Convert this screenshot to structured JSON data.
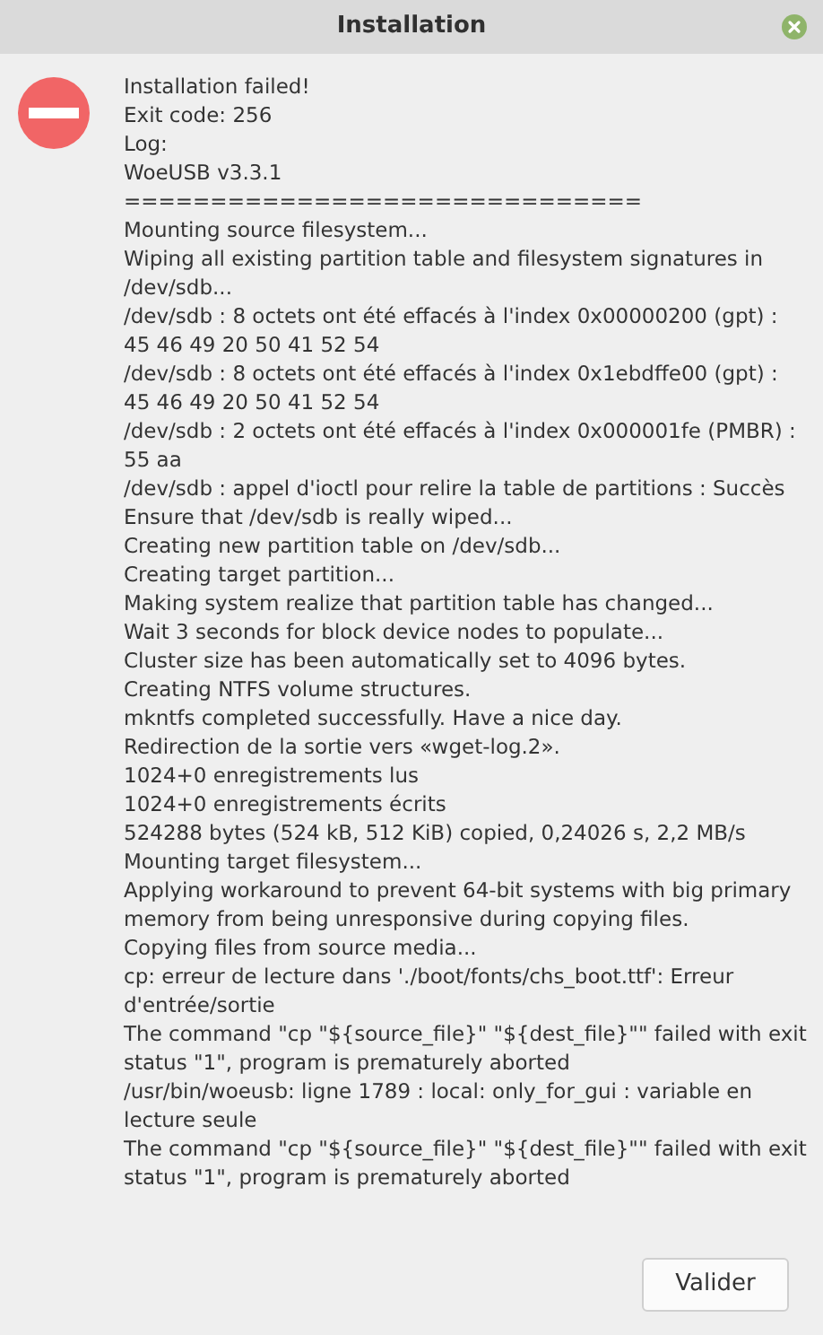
{
  "window": {
    "title": "Installation"
  },
  "log": [
    "Installation failed!",
    "Exit code: 256",
    "Log:",
    "WoeUSB v3.3.1",
    "==============================",
    "Mounting source filesystem...",
    "Wiping all existing partition table and filesystem signatures in /dev/sdb...",
    "/dev/sdb : 8 octets ont été effacés à l'index 0x00000200 (gpt) : 45 46 49 20 50 41 52 54",
    "/dev/sdb : 8 octets ont été effacés à l'index 0x1ebdffe00 (gpt) : 45 46 49 20 50 41 52 54",
    "/dev/sdb : 2 octets ont été effacés à l'index 0x000001fe (PMBR) : 55 aa",
    "/dev/sdb : appel d'ioctl pour relire la table de partitions : Succès",
    "Ensure that /dev/sdb is really wiped...",
    "Creating new partition table on /dev/sdb...",
    "Creating target partition...",
    "Making system realize that partition table has changed...",
    "Wait 3 seconds for block device nodes to populate...",
    "Cluster size has been automatically set to 4096 bytes.",
    "Creating NTFS volume structures.",
    "mkntfs completed successfully. Have a nice day.",
    "Redirection de la sortie vers «wget-log.2».",
    "1024+0 enregistrements lus",
    "1024+0 enregistrements écrits",
    "524288 bytes (524 kB, 512 KiB) copied, 0,24026 s, 2,2 MB/s",
    "Mounting target filesystem...",
    "Applying workaround to prevent 64-bit systems with big primary memory from being unresponsive during copying files.",
    "Copying files from source media...",
    "cp: erreur de lecture dans './boot/fonts/chs_boot.ttf': Erreur d'entrée/sortie",
    "The command \"cp \"${source_file}\" \"${dest_file}\"\" failed with exit status \"1\", program is prematurely aborted",
    "/usr/bin/woeusb: ligne 1789 : local: only_for_gui : variable en lecture seule",
    "The command \"cp \"${source_file}\" \"${dest_file}\"\" failed with exit status \"1\", program is prematurely aborted"
  ],
  "buttons": [
    "Valider"
  ]
}
